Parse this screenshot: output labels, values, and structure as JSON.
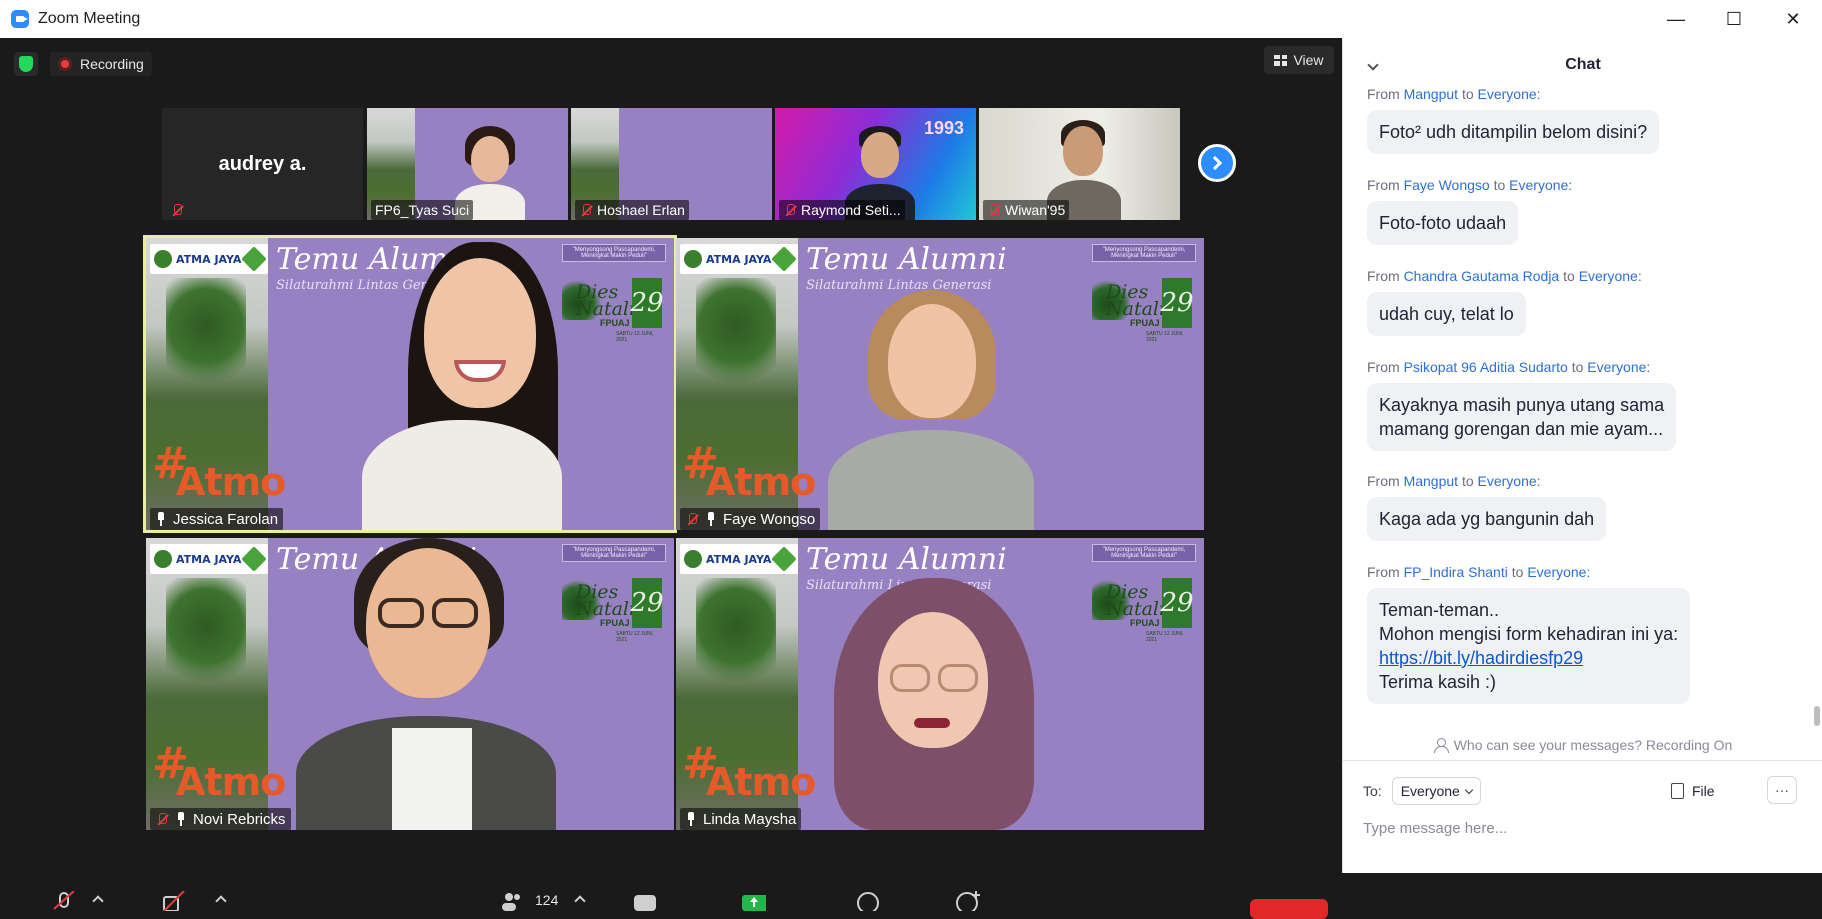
{
  "window": {
    "title": "Zoom Meeting",
    "min": "—",
    "max": "☐",
    "close": "✕"
  },
  "status": {
    "recording": "Recording"
  },
  "toolbar": {
    "view": "View"
  },
  "filmstrip": [
    {
      "name": "audrey a."
    },
    {
      "name": "FP6_Tyas Suci"
    },
    {
      "name": "Hoshael Erlan"
    },
    {
      "name": "Raymond Seti..."
    },
    {
      "name": "Wiwan'95"
    }
  ],
  "background": {
    "title": "Temu Alumni",
    "subtitle": "Silaturahmi Lintas Generasi",
    "quote": "\"Menyongsong Pascapandemi, Meningkat Makin Peduli\"",
    "logo": "ATMA JAYA",
    "dies": "Dies Natalis",
    "number": "29",
    "fpuaj": "FPUAJ",
    "date": "SABTU 12 JUNI, 2021",
    "hashtag": "#",
    "atmo": "Atmo"
  },
  "tiles": [
    {
      "name": "Jessica Farolan"
    },
    {
      "name": "Faye Wongso"
    },
    {
      "name": "Novi Rebricks"
    },
    {
      "name": "Linda Maysha"
    }
  ],
  "controls": {
    "participants_count": "124"
  },
  "chat": {
    "title": "Chat",
    "from_label": "From",
    "to_label": "to",
    "recipient": "Everyone:",
    "messages": [
      {
        "sender": "Mangput",
        "text": "Foto² udh ditampilin belom disini?"
      },
      {
        "sender": "Faye Wongso",
        "text": "Foto-foto udaah"
      },
      {
        "sender": "Chandra Gautama Rodja",
        "text": "udah cuy, telat lo"
      },
      {
        "sender": "Psikopat 96 Aditia Sudarto",
        "line1": "Kayaknya masih punya utang sama",
        "line2": "mamang gorengan dan mie ayam..."
      },
      {
        "sender": "Mangput",
        "text": "Kaga ada yg bangunin dah"
      },
      {
        "sender": "FP_Indira Shanti",
        "line1": "Teman-teman..",
        "line2": "Mohon mengisi form kehadiran ini ya:",
        "link": "https://bit.ly/hadirdiesfp29",
        "line4": "Terima kasih :)"
      }
    ],
    "privacy": "Who can see your messages? Recording On",
    "to": "To:",
    "to_select": "Everyone",
    "file": "File",
    "more": "···",
    "placeholder": "Type message here..."
  }
}
